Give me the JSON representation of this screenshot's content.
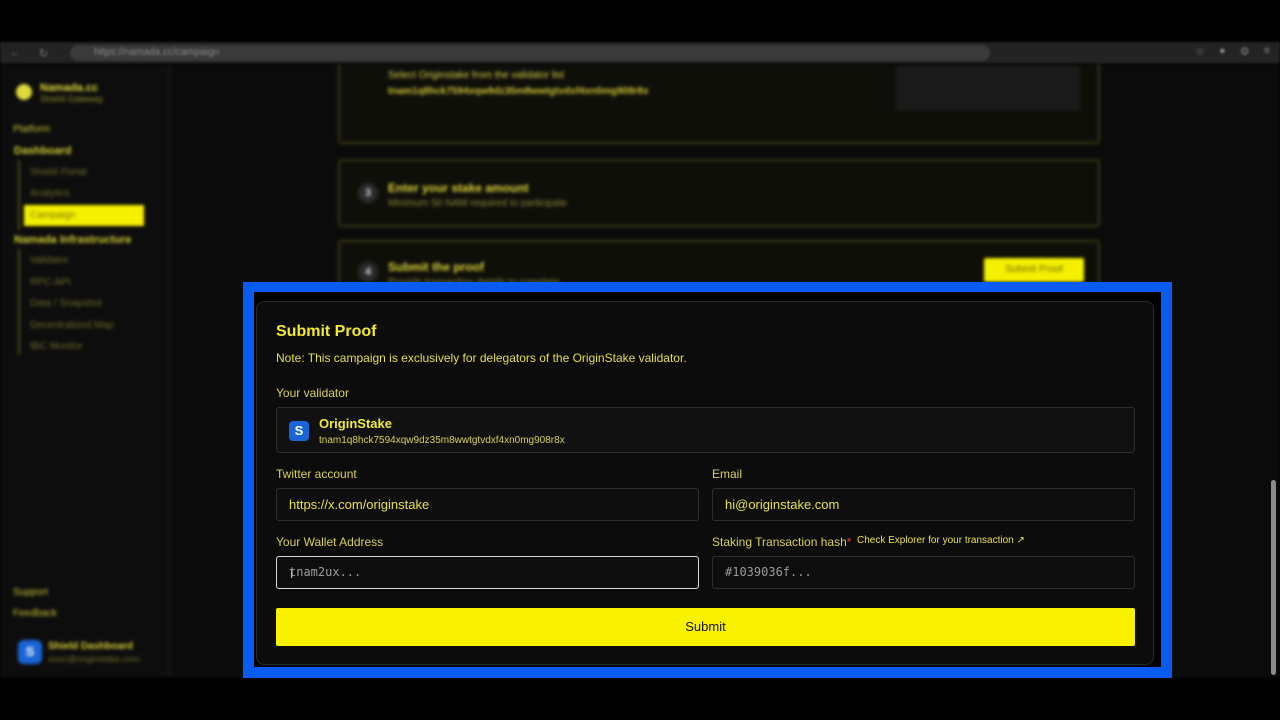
{
  "browser": {
    "url": "https://namada.cc/campaign"
  },
  "sidebar": {
    "brand": "Namada.cc",
    "brand_sub": "Shield Gateway",
    "section": "Platform",
    "group1": "Dashboard",
    "group1_items": [
      "Shield Portal",
      "Analytics",
      "Campaign"
    ],
    "group2": "Namada Infrastructure",
    "group2_items": [
      "Validator",
      "RPC-API",
      "Data / Snapshot",
      "Decentralized Map",
      "IBC Monitor"
    ],
    "support": "Support",
    "feedback": "Feedback",
    "user_name": "Shield Dashboard",
    "user_email": "soon@originstake.com",
    "user_avatar": "S"
  },
  "steps": {
    "step2_text": "Select Originstake from the validator list",
    "step2_addr": "tnam1q8hck7594xqw9dz35m8wwtgtvdxf4xn0mg908r8x",
    "step3_num": "3",
    "step3_title": "Enter your stake amount",
    "step3_sub": "Minimum 50 NAM required to participate",
    "step4_num": "4",
    "step4_title": "Submit the proof",
    "step4_sub": "Provide transaction details to complete",
    "step4_button": "Submit Proof"
  },
  "modal": {
    "title": "Submit Proof",
    "note": "Note: This campaign is exclusively for delegators of the OriginStake validator.",
    "validator_label": "Your validator",
    "validator_logo": "S",
    "validator_name": "OriginStake",
    "validator_address": "tnam1q8hck7594xqw9dz35m8wwtgtvdxf4xn0mg908r8x",
    "twitter_label": "Twitter account",
    "twitter_value": "https://x.com/originstake",
    "email_label": "Email",
    "email_value": "hi@originstake.com",
    "wallet_label": "Your Wallet Address",
    "wallet_placeholder": "tnam2ux...",
    "tx_label": "Staking Transaction hash",
    "tx_required": "*",
    "tx_explorer": "Check Explorer for your transaction",
    "tx_placeholder": "#1039036f...",
    "submit_label": "Submit"
  }
}
